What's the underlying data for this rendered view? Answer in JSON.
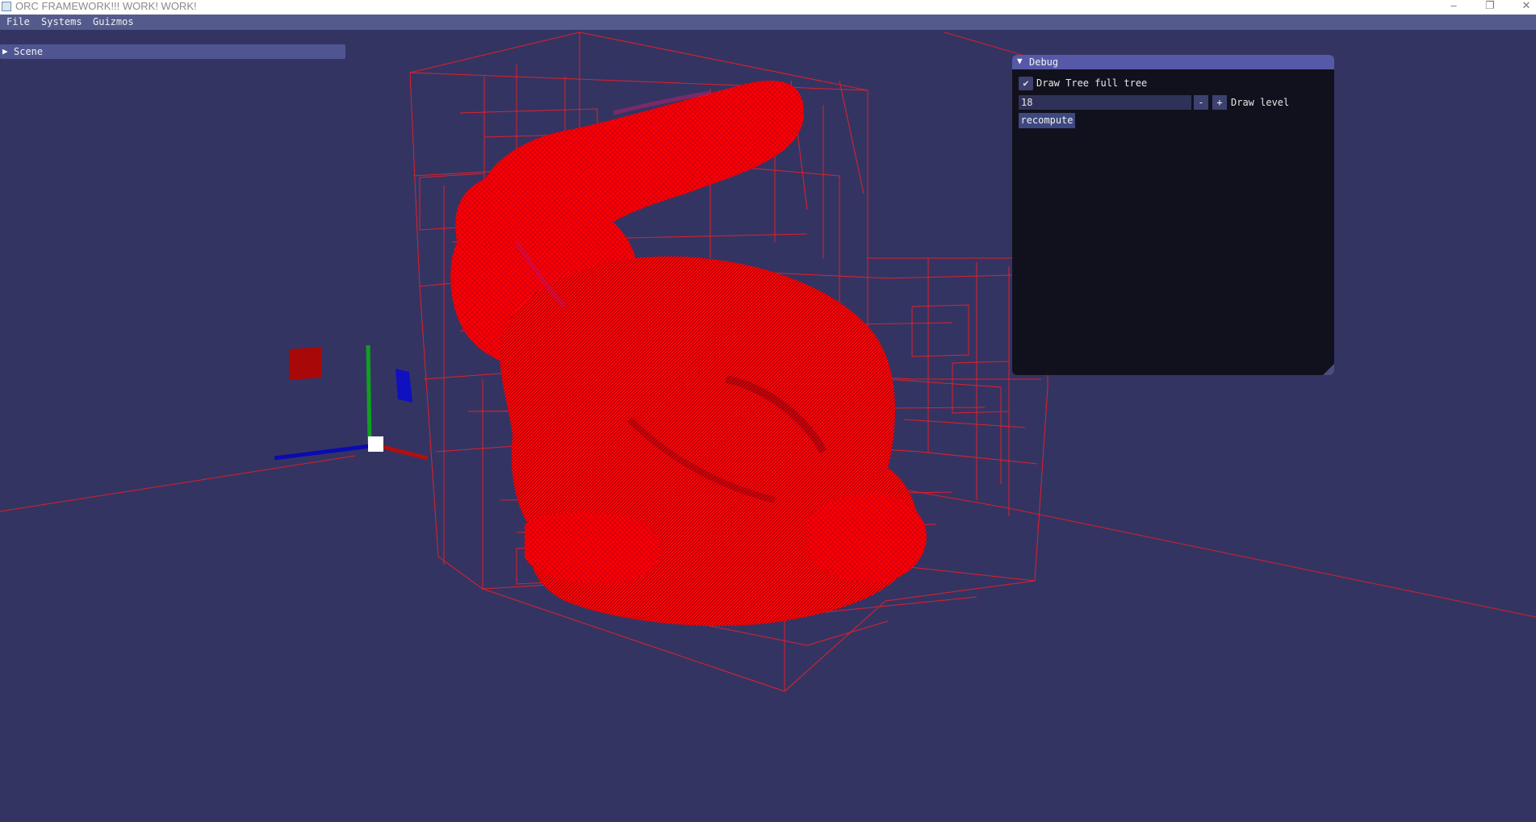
{
  "window": {
    "title": "ORC FRAMEWORK!!! WORK! WORK!",
    "controls": {
      "minimize": "–",
      "maximize": "❐",
      "close": "✕"
    }
  },
  "menubar": {
    "items": [
      {
        "label": "File"
      },
      {
        "label": "Systems"
      },
      {
        "label": "Guizmos"
      }
    ]
  },
  "scene_panel": {
    "label": "Scene"
  },
  "debug_window": {
    "title": "Debug",
    "draw_tree_checkbox": {
      "label": "Draw Tree full tree",
      "checked": true
    },
    "draw_level": {
      "value": "18",
      "label": "Draw level",
      "decrement": "-",
      "increment": "+"
    },
    "recompute_button": {
      "label": "recompute"
    }
  },
  "colors": {
    "background": "#343462",
    "mesh": "#ff0000",
    "octree_lines": "#e8202a",
    "menubar": "#545b8c",
    "panel_header": "#5659a8",
    "gizmo_x": "#c01010",
    "gizmo_y": "#10a020",
    "gizmo_z": "#1010c0"
  },
  "icons": {
    "app": "app-window-icon",
    "collapse": "triangle-right-icon",
    "expand": "triangle-down-icon",
    "check": "checkmark-icon"
  }
}
